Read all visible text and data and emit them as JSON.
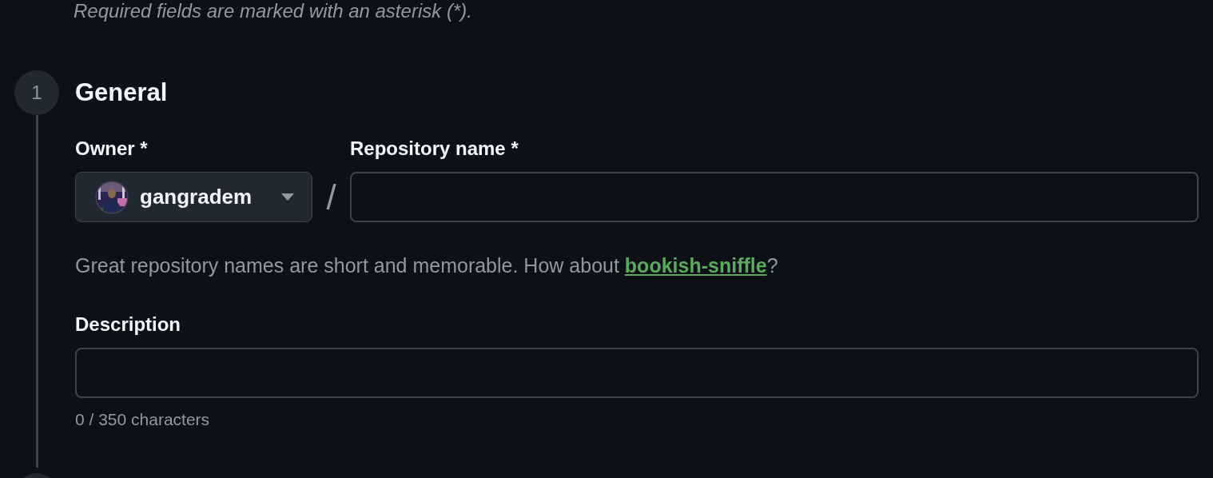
{
  "intro": "Required fields are marked with an asterisk (*).",
  "step": {
    "number": "1",
    "title": "General"
  },
  "owner": {
    "label": "Owner *",
    "value": "gangradem"
  },
  "separator": "/",
  "repository_name": {
    "label": "Repository name *"
  },
  "hint": {
    "text": "Great repository names are short and memorable. How about ",
    "link": "bookish-sniffle",
    "after": "?"
  },
  "description": {
    "label": "Description",
    "counter": "0 / 350 characters"
  }
}
